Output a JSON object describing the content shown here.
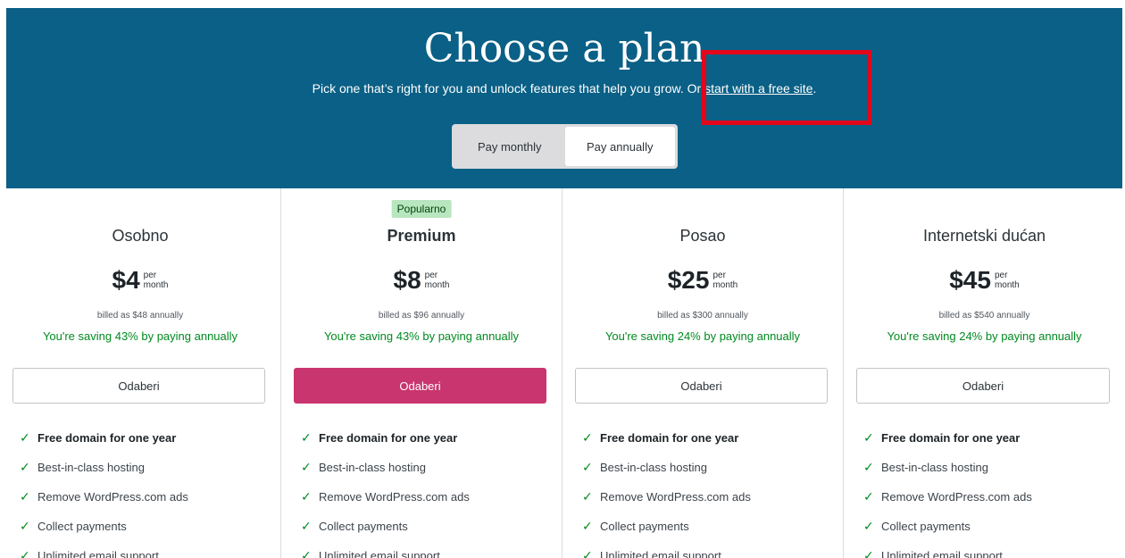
{
  "header": {
    "title": "Choose a plan",
    "subtitle": "Pick one that’s right for you and unlock features that help you grow.",
    "or_text": " Or ",
    "free_site_link": "start with a free site",
    "period": ".",
    "toggle": {
      "monthly_label": "Pay monthly",
      "annually_label": "Pay annually",
      "selected": "annually"
    }
  },
  "colors": {
    "header_bg": "#0a6086",
    "primary_button": "#c9356e",
    "saving_text": "#008a20",
    "badge_bg": "#b8e6bf",
    "highlight_border": "#e3061a"
  },
  "plans": [
    {
      "name": "Osobno",
      "badge": "",
      "price": "$4",
      "per": "per",
      "period": "month",
      "billed": "billed as $48 annually",
      "saving": "You're saving 43% by paying annually",
      "button_label": "Odaberi",
      "features": [
        "Free domain for one year",
        "Best-in-class hosting",
        "Remove WordPress.com ads",
        "Collect payments",
        "Unlimited email support"
      ]
    },
    {
      "name": "Premium",
      "badge": "Popularno",
      "price": "$8",
      "per": "per",
      "period": "month",
      "billed": "billed as $96 annually",
      "saving": "You're saving 43% by paying annually",
      "button_label": "Odaberi",
      "features": [
        "Free domain for one year",
        "Best-in-class hosting",
        "Remove WordPress.com ads",
        "Collect payments",
        "Unlimited email support"
      ]
    },
    {
      "name": "Posao",
      "badge": "",
      "price": "$25",
      "per": "per",
      "period": "month",
      "billed": "billed as $300 annually",
      "saving": "You're saving 24% by paying annually",
      "button_label": "Odaberi",
      "features": [
        "Free domain for one year",
        "Best-in-class hosting",
        "Remove WordPress.com ads",
        "Collect payments",
        "Unlimited email support"
      ]
    },
    {
      "name": "Internetski dućan",
      "badge": "",
      "price": "$45",
      "per": "per",
      "period": "month",
      "billed": "billed as $540 annually",
      "saving": "You're saving 24% by paying annually",
      "button_label": "Odaberi",
      "features": [
        "Free domain for one year",
        "Best-in-class hosting",
        "Remove WordPress.com ads",
        "Collect payments",
        "Unlimited email support"
      ]
    }
  ]
}
